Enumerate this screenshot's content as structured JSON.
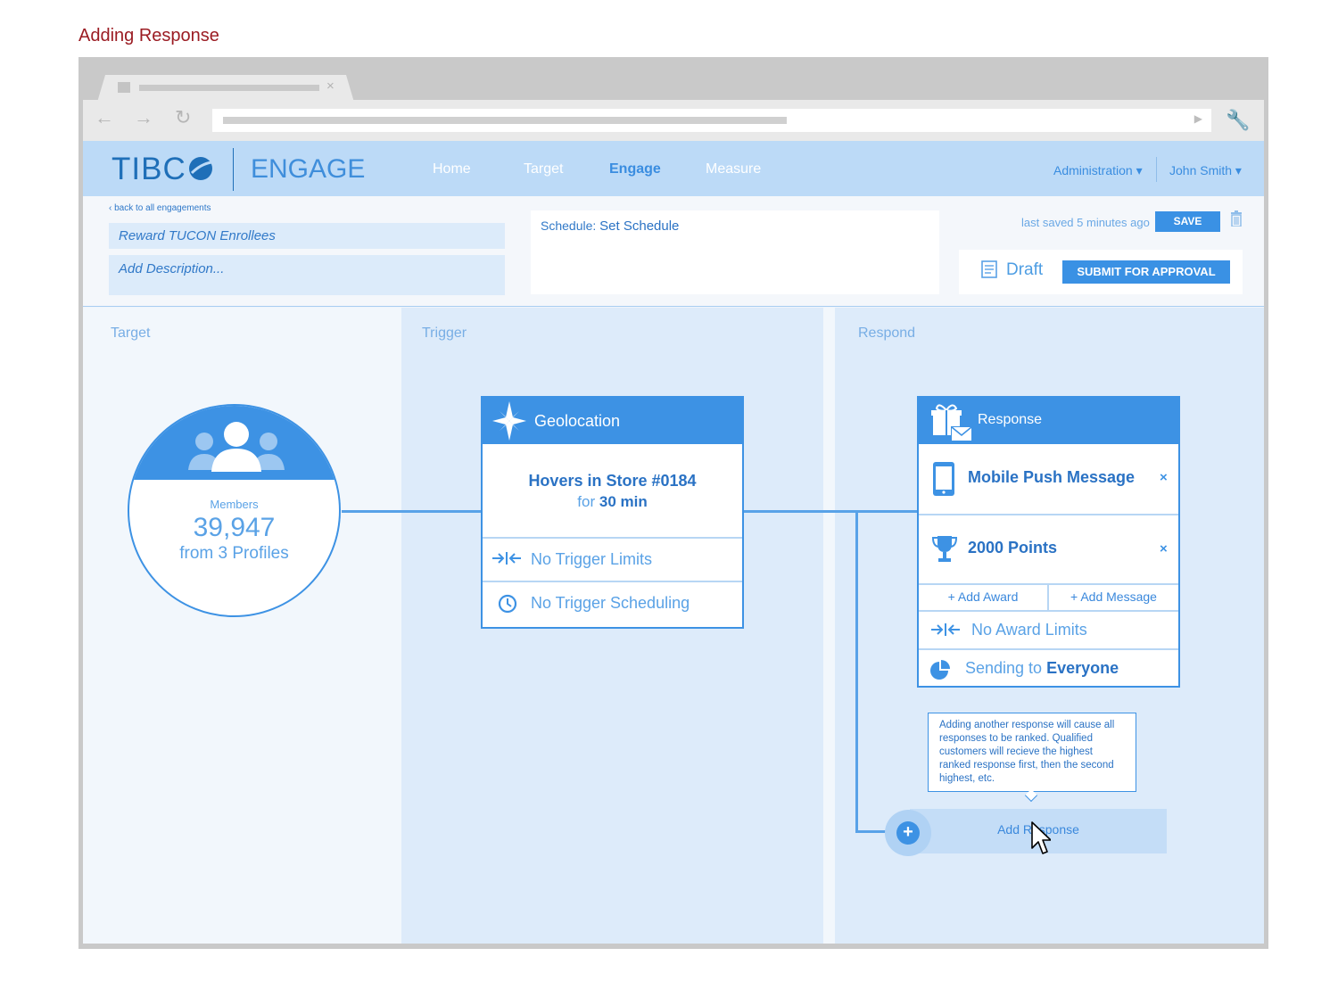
{
  "caption": "Adding Response",
  "browser": {
    "tab_close": "×",
    "nav_back": "←",
    "nav_forward": "→",
    "nav_reload": "↻",
    "addr_go": "▶",
    "wrench": "🔧"
  },
  "app": {
    "logo": "TIBC",
    "product": "ENGAGE",
    "nav": [
      "Home",
      "Target",
      "Engage",
      "Measure"
    ],
    "active_nav": "Engage",
    "admin_menu": "Administration ▾",
    "user_menu": "John Smith ▾"
  },
  "header": {
    "back_link": "‹ back to all engagements",
    "name": "Reward TUCON Enrollees",
    "description_placeholder": "Add Description...",
    "schedule_label": "Schedule:",
    "schedule_value": "Set Schedule",
    "last_saved": "last saved 5 minutes ago",
    "save_label": "SAVE",
    "status": "Draft",
    "submit_label": "SUBMIT FOR APPROVAL"
  },
  "columns": {
    "target": "Target",
    "trigger": "Trigger",
    "respond": "Respond"
  },
  "target": {
    "label": "Members",
    "count": "39,947",
    "sub": "from 3 Profiles"
  },
  "trigger": {
    "title": "Geolocation",
    "main": "Hovers in Store #0184",
    "sub_prefix": "for",
    "sub_value": "30 min",
    "limits": "No Trigger Limits",
    "scheduling": "No Trigger Scheduling"
  },
  "response": {
    "title": "Response",
    "items": [
      {
        "label": "Mobile Push Message",
        "remove": "×"
      },
      {
        "label": "2000 Points",
        "remove": "×"
      }
    ],
    "add_award": "+ Add Award",
    "add_message": "+ Add Message",
    "award_limits": "No Award Limits",
    "sending_prefix": "Sending to",
    "sending_value": "Everyone"
  },
  "tooltip": "Adding another response will cause all responses to be ranked. Qualified customers will recieve the highest ranked response first, then the second highest, etc.",
  "add_response": {
    "label": "Add Response",
    "plus": "+"
  },
  "colors": {
    "accent": "#3d92e4",
    "topbar": "#bcdaf7",
    "caption": "#9b1c23"
  }
}
